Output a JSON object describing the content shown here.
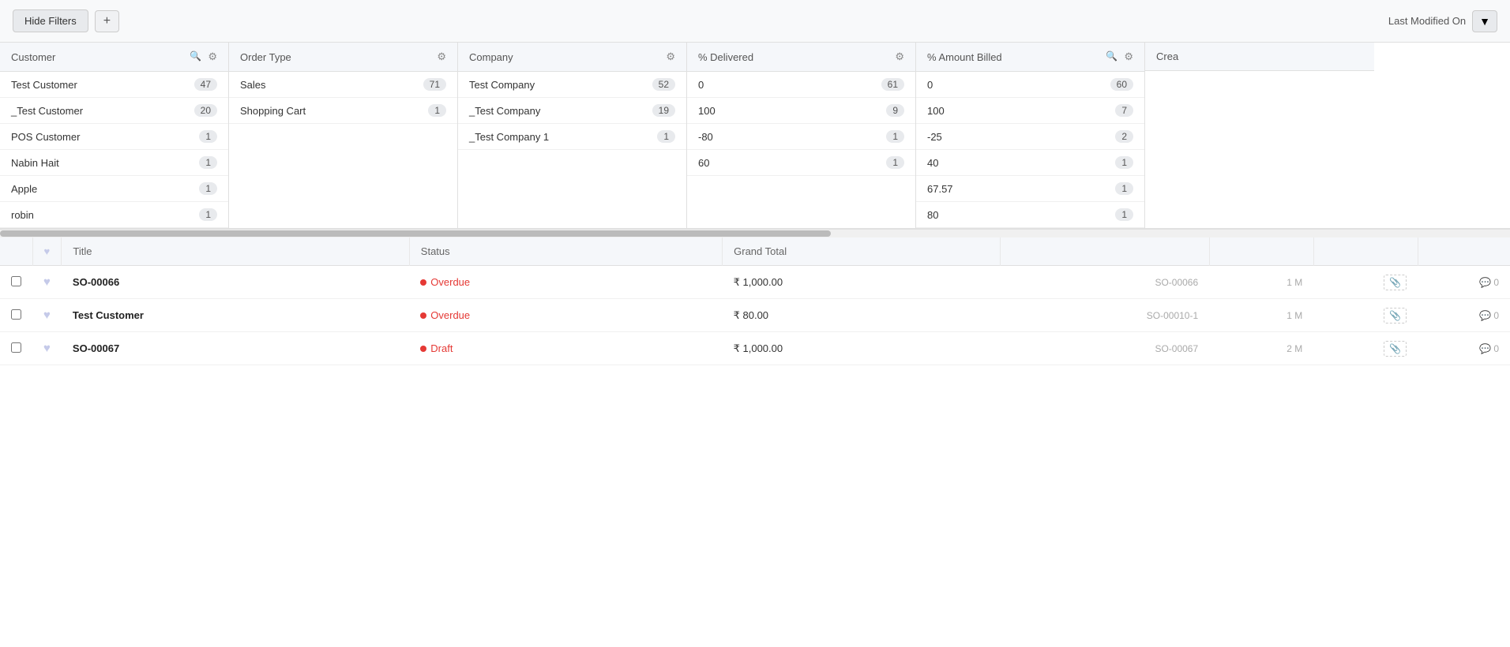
{
  "toolbar": {
    "hide_filters_label": "Hide Filters",
    "add_label": "+",
    "last_modified_label": "Last Modified On",
    "sort_icon": "▼"
  },
  "filters": [
    {
      "id": "customer",
      "header": "Customer",
      "has_search": true,
      "has_gear": true,
      "rows": [
        {
          "label": "Test Customer",
          "count": "47"
        },
        {
          "label": "_Test Customer",
          "count": "20"
        },
        {
          "label": "POS Customer",
          "count": "1"
        },
        {
          "label": "Nabin Hait",
          "count": "1"
        },
        {
          "label": "Apple",
          "count": "1"
        },
        {
          "label": "robin",
          "count": "1"
        }
      ]
    },
    {
      "id": "order_type",
      "header": "Order Type",
      "has_search": false,
      "has_gear": true,
      "rows": [
        {
          "label": "Sales",
          "count": "71"
        },
        {
          "label": "Shopping Cart",
          "count": "1"
        }
      ]
    },
    {
      "id": "company",
      "header": "Company",
      "has_search": false,
      "has_gear": true,
      "rows": [
        {
          "label": "Test Company",
          "count": "52"
        },
        {
          "label": "_Test Company",
          "count": "19"
        },
        {
          "label": "_Test Company 1",
          "count": "1"
        }
      ]
    },
    {
      "id": "percent_delivered",
      "header": "% Delivered",
      "has_search": false,
      "has_gear": true,
      "rows": [
        {
          "label": "0",
          "count": "61"
        },
        {
          "label": "100",
          "count": "9"
        },
        {
          "label": "-80",
          "count": "1"
        },
        {
          "label": "60",
          "count": "1"
        }
      ]
    },
    {
      "id": "percent_amount_billed",
      "header": "% Amount Billed",
      "has_search": true,
      "has_gear": true,
      "rows": [
        {
          "label": "0",
          "count": "60"
        },
        {
          "label": "100",
          "count": "7"
        },
        {
          "label": "-25",
          "count": "2"
        },
        {
          "label": "40",
          "count": "1"
        },
        {
          "label": "67.57",
          "count": "1"
        },
        {
          "label": "80",
          "count": "1"
        }
      ]
    },
    {
      "id": "created",
      "header": "Crea",
      "has_search": false,
      "has_gear": false,
      "rows": []
    }
  ],
  "table": {
    "columns": [
      {
        "id": "checkbox",
        "label": ""
      },
      {
        "id": "fav",
        "label": "♥"
      },
      {
        "id": "title",
        "label": "Title"
      },
      {
        "id": "status",
        "label": "Status"
      },
      {
        "id": "grand_total",
        "label": "Grand Total"
      },
      {
        "id": "ref",
        "label": ""
      },
      {
        "id": "age",
        "label": ""
      },
      {
        "id": "attachments",
        "label": ""
      },
      {
        "id": "comments",
        "label": ""
      }
    ],
    "rows": [
      {
        "id": "row1",
        "title": "SO-00066",
        "status": "Overdue",
        "status_type": "overdue",
        "grand_total": "₹ 1,000.00",
        "ref": "SO-00066",
        "age": "1 M",
        "attachments": "",
        "comments": "0"
      },
      {
        "id": "row2",
        "title": "Test Customer",
        "status": "Overdue",
        "status_type": "overdue",
        "grand_total": "₹ 80.00",
        "ref": "SO-00010-1",
        "age": "1 M",
        "attachments": "",
        "comments": "0"
      },
      {
        "id": "row3",
        "title": "SO-00067",
        "status": "Draft",
        "status_type": "draft",
        "grand_total": "₹ 1,000.00",
        "ref": "SO-00067",
        "age": "2 M",
        "attachments": "",
        "comments": "0"
      }
    ]
  }
}
